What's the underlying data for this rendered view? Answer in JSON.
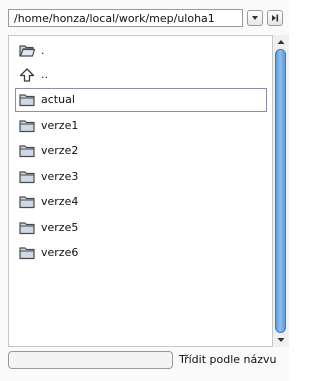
{
  "path_bar": {
    "current_path": "/home/honza/local/work/mep/uloha1",
    "dropdown_icon": "chevron-down-icon",
    "go_icon": "go-to-end-icon"
  },
  "file_list": {
    "items": [
      {
        "label": ".",
        "icon": "open-folder-icon"
      },
      {
        "label": "..",
        "icon": "up-arrow-icon"
      },
      {
        "label": "actual",
        "icon": "folder-icon"
      },
      {
        "label": "verze1",
        "icon": "folder-icon"
      },
      {
        "label": "verze2",
        "icon": "folder-icon"
      },
      {
        "label": "verze3",
        "icon": "folder-icon"
      },
      {
        "label": "verze4",
        "icon": "folder-icon"
      },
      {
        "label": "verze5",
        "icon": "folder-icon"
      },
      {
        "label": "verze6",
        "icon": "folder-icon"
      }
    ],
    "selected_item": "actual"
  },
  "status_bar": {
    "filter_value": "",
    "sort_label": "Třídit podle názvu"
  },
  "colors": {
    "scrollbar_thumb": "#5d9ad8",
    "selection_border": "#8a8fb0",
    "folder_fill": "#cfd8e6",
    "folder_stroke": "#4a4a4a"
  }
}
